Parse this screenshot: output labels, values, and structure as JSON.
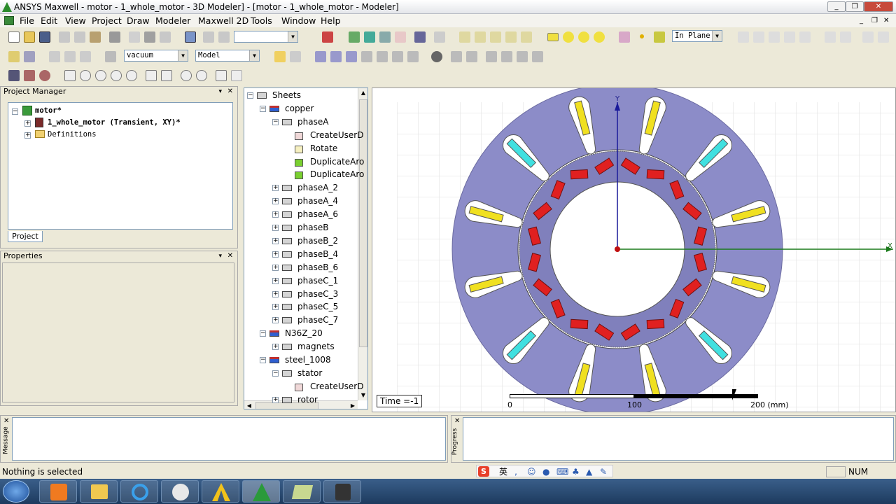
{
  "window": {
    "title": "ANSYS Maxwell - motor - 1_whole_motor - 3D Modeler] - [motor - 1_whole_motor - Modeler]"
  },
  "menu": [
    "File",
    "Edit",
    "View",
    "Project",
    "Draw",
    "Modeler",
    "Maxwell 2D",
    "Tools",
    "Window",
    "Help"
  ],
  "toolbar": {
    "material": "vacuum",
    "model": "Model",
    "plane": "In Plane"
  },
  "project_manager": {
    "title": "Project Manager",
    "root": "motor*",
    "design": "1_whole_motor (Transient, XY)*",
    "definitions": "Definitions",
    "tab": "Project"
  },
  "properties": {
    "title": "Properties"
  },
  "tree": [
    {
      "label": "Sheets",
      "type": "folder"
    },
    {
      "label": "copper",
      "type": "material",
      "color": "#2f5fd0"
    },
    {
      "label": "phaseA",
      "type": "part"
    },
    {
      "label": "CreateUserD",
      "type": "op"
    },
    {
      "label": "Rotate",
      "type": "op"
    },
    {
      "label": "DuplicateAro",
      "type": "op"
    },
    {
      "label": "DuplicateAro",
      "type": "op"
    },
    {
      "label": "phaseA_2",
      "type": "part"
    },
    {
      "label": "phaseA_4",
      "type": "part"
    },
    {
      "label": "phaseA_6",
      "type": "part"
    },
    {
      "label": "phaseB",
      "type": "part"
    },
    {
      "label": "phaseB_2",
      "type": "part"
    },
    {
      "label": "phaseB_4",
      "type": "part"
    },
    {
      "label": "phaseB_6",
      "type": "part"
    },
    {
      "label": "phaseC_1",
      "type": "part"
    },
    {
      "label": "phaseC_3",
      "type": "part"
    },
    {
      "label": "phaseC_5",
      "type": "part"
    },
    {
      "label": "phaseC_7",
      "type": "part"
    },
    {
      "label": "N36Z_20",
      "type": "material",
      "color": "#2f5fd0"
    },
    {
      "label": "magnets",
      "type": "part"
    },
    {
      "label": "steel_1008",
      "type": "material",
      "color": "#2f5fd0"
    },
    {
      "label": "stator",
      "type": "part"
    },
    {
      "label": "CreateUserD",
      "type": "op"
    },
    {
      "label": "rotor",
      "type": "part"
    }
  ],
  "viewport": {
    "time": "Time =-1",
    "axis_x": "X",
    "axis_y": "Y",
    "scale": [
      "0",
      "100",
      "200 (mm)"
    ]
  },
  "panels": {
    "message": "Message",
    "progress": "Progress"
  },
  "status": {
    "text": "Nothing is selected",
    "num": "NUM"
  },
  "ime": "英"
}
